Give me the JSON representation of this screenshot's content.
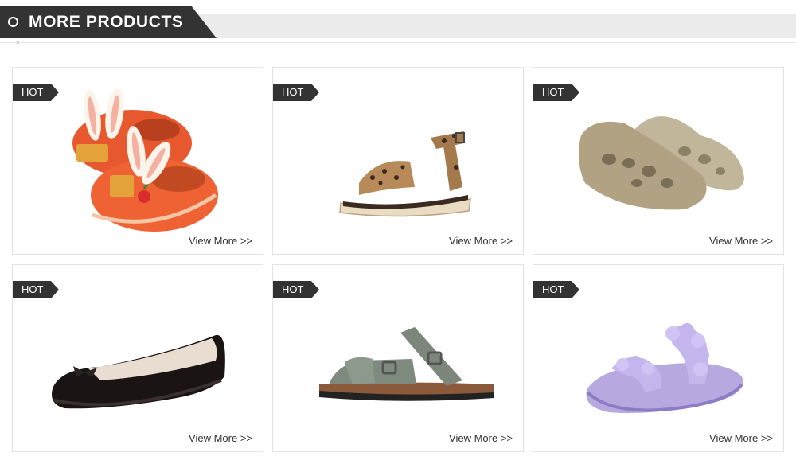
{
  "header": {
    "title": "MORE PRODUCTS"
  },
  "products": [
    {
      "badge": "HOT",
      "link_label": "View More >>",
      "image_icon": "bunny-slipper-icon"
    },
    {
      "badge": "HOT",
      "link_label": "View More >>",
      "image_icon": "leopard-espadrille-sandal-icon"
    },
    {
      "badge": "HOT",
      "link_label": "View More >>",
      "image_icon": "foam-clog-icon"
    },
    {
      "badge": "HOT",
      "link_label": "View More >>",
      "image_icon": "black-ballet-flat-icon"
    },
    {
      "badge": "HOT",
      "link_label": "View More >>",
      "image_icon": "cork-strap-sandal-icon"
    },
    {
      "badge": "HOT",
      "link_label": "View More >>",
      "image_icon": "braided-purple-slide-icon"
    }
  ],
  "colors": {
    "dark": "#333333",
    "strip": "#ececec",
    "border": "#e3e3e3"
  }
}
